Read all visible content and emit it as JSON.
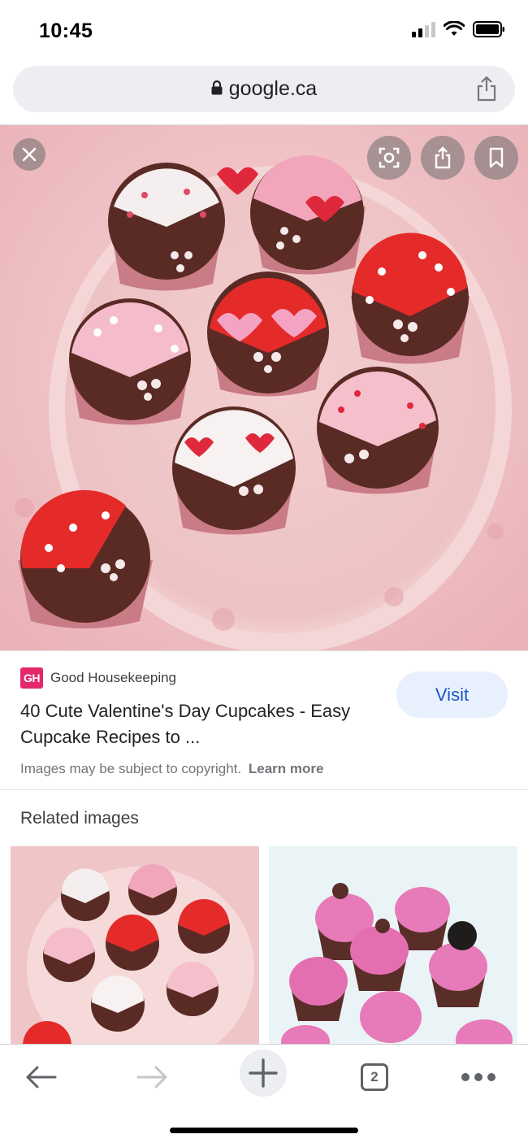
{
  "status_bar": {
    "time": "10:45"
  },
  "url_bar": {
    "domain": "google.ca"
  },
  "result": {
    "source_logo": "GH",
    "source_name": "Good Housekeeping",
    "title": "40 Cute Valentine's Day Cupcakes - Easy Cupcake Recipes to ...",
    "visit_label": "Visit",
    "copyright_text": "Images may be subject to copyright.",
    "learn_more_label": "Learn more"
  },
  "related": {
    "heading": "Related images"
  },
  "toolbar": {
    "tab_count": "2"
  },
  "colors": {
    "visit_bg": "#e8f0fe",
    "visit_text": "#1a56c4",
    "gh_brand": "#e5286c",
    "url_bar_bg": "#eceef1"
  },
  "icons": [
    "lock-icon",
    "share-icon",
    "close-icon",
    "lens-icon",
    "bookmark-icon",
    "back-icon",
    "forward-icon",
    "new-tab-icon",
    "more-icon"
  ]
}
